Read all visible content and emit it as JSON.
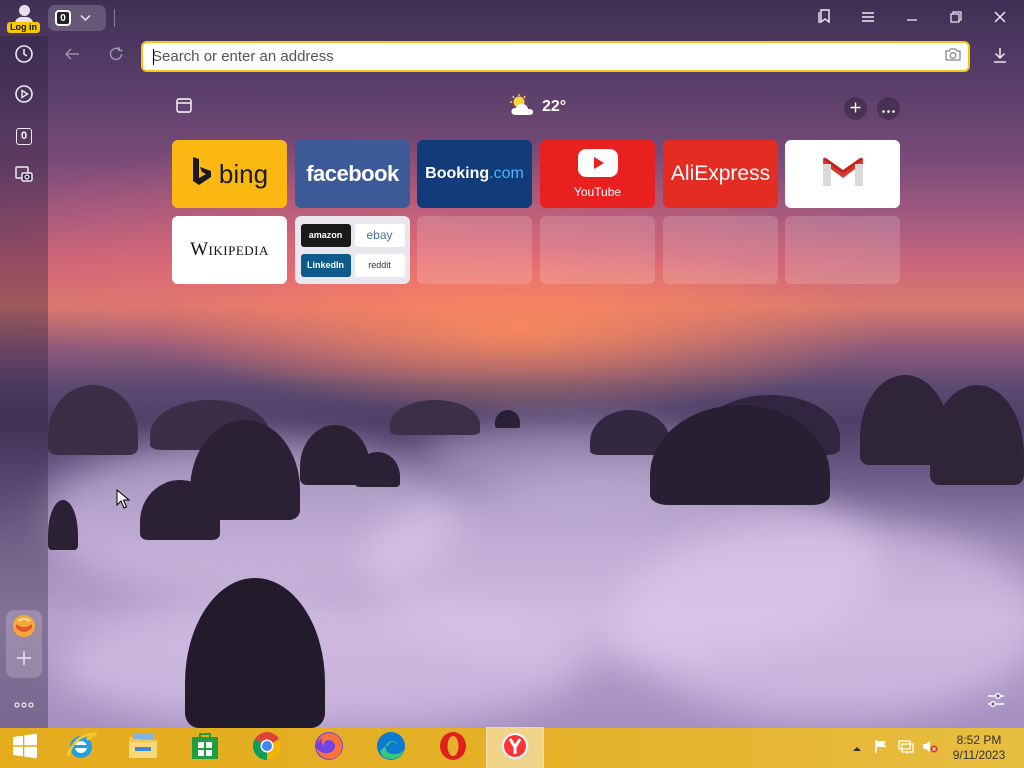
{
  "user": {
    "login_label": "Log in"
  },
  "tabs": {
    "count": "0"
  },
  "sidebar": {
    "tabs_count": "0"
  },
  "address": {
    "placeholder": "Search or enter an address"
  },
  "weather": {
    "temperature": "22°"
  },
  "tiles_row1": [
    {
      "name": "bing",
      "label": "bing"
    },
    {
      "name": "facebook",
      "label": "facebook"
    },
    {
      "name": "booking",
      "label": "Booking",
      "suffix": ".com"
    },
    {
      "name": "youtube",
      "label": "YouTube"
    },
    {
      "name": "aliexpress",
      "label": "AliExpress"
    },
    {
      "name": "gmail",
      "label": ""
    }
  ],
  "tiles_row2": [
    {
      "name": "wikipedia",
      "label": "Wikipedia"
    },
    {
      "name": "multi",
      "items": [
        "amazon",
        "ebay",
        "LinkedIn",
        "reddit"
      ]
    }
  ],
  "taskbar": {
    "apps": [
      "start-icon",
      "internet-explorer-icon",
      "file-explorer-icon",
      "store-icon",
      "chrome-icon",
      "firefox-icon",
      "edge-icon",
      "opera-icon",
      "yandex-browser-icon"
    ],
    "time": "8:52 PM",
    "date": "9/11/2023"
  },
  "colors": {
    "accent_yellow": "#f5c518",
    "taskbar": "#e5ac1d"
  }
}
